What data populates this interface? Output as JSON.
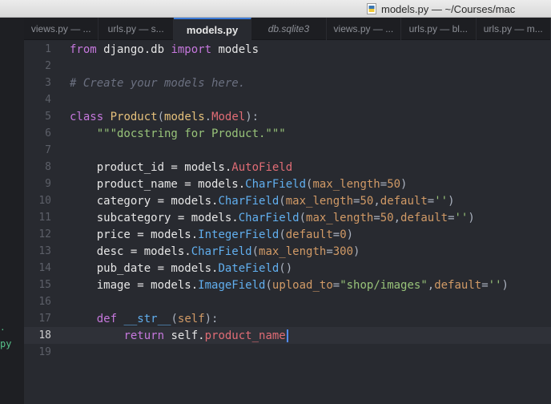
{
  "window": {
    "title": "models.py — ~/Courses/mac"
  },
  "sidebar": {
    "fragment": "py",
    "tick": "."
  },
  "tabs": [
    {
      "label": "views.py — ...",
      "active": false,
      "italic": false
    },
    {
      "label": "urls.py — s...",
      "active": false,
      "italic": false
    },
    {
      "label": "models.py",
      "active": true,
      "italic": false
    },
    {
      "label": "db.sqlite3",
      "active": false,
      "italic": true
    },
    {
      "label": "views.py — ...",
      "active": false,
      "italic": false
    },
    {
      "label": "urls.py — bl...",
      "active": false,
      "italic": false
    },
    {
      "label": "urls.py — m...",
      "active": false,
      "italic": false
    }
  ],
  "editor": {
    "current_line": 18,
    "lines": [
      {
        "n": "1",
        "tokens": [
          {
            "t": "from",
            "c": "kw"
          },
          {
            "t": " django.db ",
            "c": "pl"
          },
          {
            "t": "import",
            "c": "kw"
          },
          {
            "t": " models",
            "c": "pl"
          }
        ]
      },
      {
        "n": "2",
        "tokens": []
      },
      {
        "n": "3",
        "tokens": [
          {
            "t": "# Create your models here.",
            "c": "cm"
          }
        ]
      },
      {
        "n": "4",
        "tokens": []
      },
      {
        "n": "5",
        "tokens": [
          {
            "t": "class",
            "c": "kw"
          },
          {
            "t": " ",
            "c": "pl"
          },
          {
            "t": "Product",
            "c": "cls"
          },
          {
            "t": "(",
            "c": "pu"
          },
          {
            "t": "models",
            "c": "mod"
          },
          {
            "t": ".",
            "c": "pu"
          },
          {
            "t": "Model",
            "c": "ty"
          },
          {
            "t": "):",
            "c": "pu"
          }
        ]
      },
      {
        "n": "6",
        "tokens": [
          {
            "t": "    ",
            "c": "pl"
          },
          {
            "t": "\"\"\"docstring for Product.\"\"\"",
            "c": "st"
          }
        ]
      },
      {
        "n": "7",
        "tokens": []
      },
      {
        "n": "8",
        "tokens": [
          {
            "t": "    product_id = models.",
            "c": "pl"
          },
          {
            "t": "AutoField",
            "c": "ty"
          }
        ]
      },
      {
        "n": "9",
        "tokens": [
          {
            "t": "    product_name = models.",
            "c": "pl"
          },
          {
            "t": "CharField",
            "c": "fn"
          },
          {
            "t": "(",
            "c": "pu"
          },
          {
            "t": "max_length",
            "c": "nu"
          },
          {
            "t": "=",
            "c": "pu"
          },
          {
            "t": "50",
            "c": "nu"
          },
          {
            "t": ")",
            "c": "pu"
          }
        ]
      },
      {
        "n": "10",
        "tokens": [
          {
            "t": "    category = models.",
            "c": "pl"
          },
          {
            "t": "CharField",
            "c": "fn"
          },
          {
            "t": "(",
            "c": "pu"
          },
          {
            "t": "max_length",
            "c": "nu"
          },
          {
            "t": "=",
            "c": "pu"
          },
          {
            "t": "50",
            "c": "nu"
          },
          {
            "t": ",",
            "c": "pu"
          },
          {
            "t": "default",
            "c": "nu"
          },
          {
            "t": "=",
            "c": "pu"
          },
          {
            "t": "''",
            "c": "st"
          },
          {
            "t": ")",
            "c": "pu"
          }
        ]
      },
      {
        "n": "11",
        "tokens": [
          {
            "t": "    subcategory = models.",
            "c": "pl"
          },
          {
            "t": "CharField",
            "c": "fn"
          },
          {
            "t": "(",
            "c": "pu"
          },
          {
            "t": "max_length",
            "c": "nu"
          },
          {
            "t": "=",
            "c": "pu"
          },
          {
            "t": "50",
            "c": "nu"
          },
          {
            "t": ",",
            "c": "pu"
          },
          {
            "t": "default",
            "c": "nu"
          },
          {
            "t": "=",
            "c": "pu"
          },
          {
            "t": "''",
            "c": "st"
          },
          {
            "t": ")",
            "c": "pu"
          }
        ]
      },
      {
        "n": "12",
        "tokens": [
          {
            "t": "    price = models.",
            "c": "pl"
          },
          {
            "t": "IntegerField",
            "c": "fn"
          },
          {
            "t": "(",
            "c": "pu"
          },
          {
            "t": "default",
            "c": "nu"
          },
          {
            "t": "=",
            "c": "pu"
          },
          {
            "t": "0",
            "c": "nu"
          },
          {
            "t": ")",
            "c": "pu"
          }
        ]
      },
      {
        "n": "13",
        "tokens": [
          {
            "t": "    desc = models.",
            "c": "pl"
          },
          {
            "t": "CharField",
            "c": "fn"
          },
          {
            "t": "(",
            "c": "pu"
          },
          {
            "t": "max_length",
            "c": "nu"
          },
          {
            "t": "=",
            "c": "pu"
          },
          {
            "t": "300",
            "c": "nu"
          },
          {
            "t": ")",
            "c": "pu"
          }
        ]
      },
      {
        "n": "14",
        "tokens": [
          {
            "t": "    pub_date = models.",
            "c": "pl"
          },
          {
            "t": "DateField",
            "c": "fn"
          },
          {
            "t": "()",
            "c": "pu"
          }
        ]
      },
      {
        "n": "15",
        "tokens": [
          {
            "t": "    image = models.",
            "c": "pl"
          },
          {
            "t": "ImageField",
            "c": "fn"
          },
          {
            "t": "(",
            "c": "pu"
          },
          {
            "t": "upload_to",
            "c": "nu"
          },
          {
            "t": "=",
            "c": "pu"
          },
          {
            "t": "\"shop/images\"",
            "c": "st"
          },
          {
            "t": ",",
            "c": "pu"
          },
          {
            "t": "default",
            "c": "nu"
          },
          {
            "t": "=",
            "c": "pu"
          },
          {
            "t": "''",
            "c": "st"
          },
          {
            "t": ")",
            "c": "pu"
          }
        ]
      },
      {
        "n": "16",
        "tokens": []
      },
      {
        "n": "17",
        "tokens": [
          {
            "t": "    ",
            "c": "pl"
          },
          {
            "t": "def",
            "c": "kw"
          },
          {
            "t": " ",
            "c": "pl"
          },
          {
            "t": "__str__",
            "c": "fn"
          },
          {
            "t": "(",
            "c": "pu"
          },
          {
            "t": "self",
            "c": "nu"
          },
          {
            "t": "):",
            "c": "pu"
          }
        ]
      },
      {
        "n": "18",
        "tokens": [
          {
            "t": "        ",
            "c": "pl"
          },
          {
            "t": "return",
            "c": "kw"
          },
          {
            "t": " self.",
            "c": "pl"
          },
          {
            "t": "product_name",
            "c": "attr"
          }
        ]
      },
      {
        "n": "19",
        "tokens": []
      }
    ]
  }
}
